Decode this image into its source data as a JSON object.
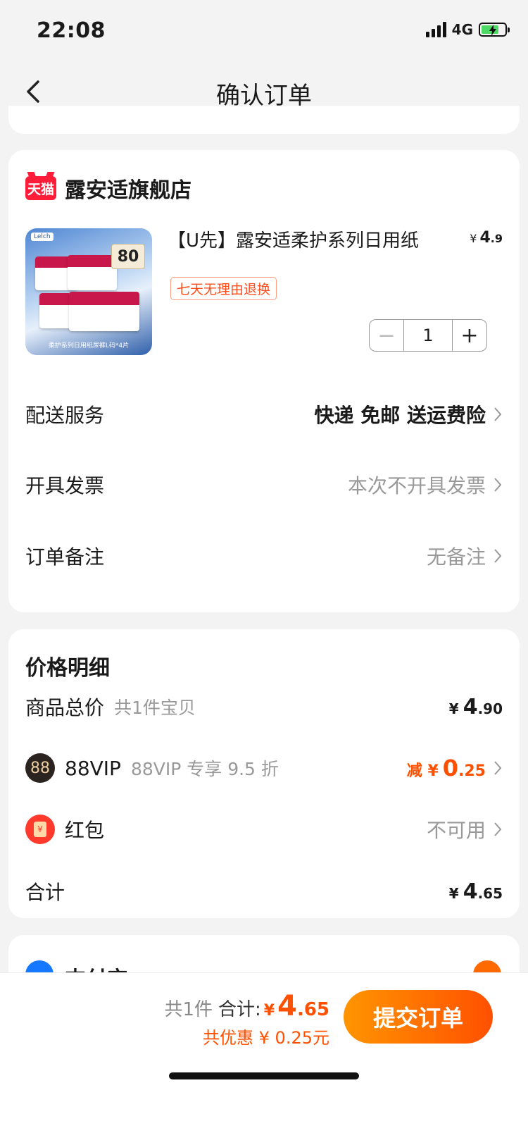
{
  "status": {
    "time": "22:08",
    "network": "4G"
  },
  "nav": {
    "title": "确认订单"
  },
  "store": {
    "logo_text": "天猫",
    "name": "露安适旗舰店",
    "product": {
      "title": "【U先】露安适柔护系列日用纸",
      "price_symbol": "¥",
      "price_int": "4",
      "price_dec": ".9",
      "tag": "七天无理由退换",
      "quantity": "1",
      "image_badge": "80",
      "image_brand": "Lelch",
      "image_caption": "柔护系列日用纸尿裤L码*4片"
    }
  },
  "rows": {
    "delivery": {
      "label": "配送服务",
      "value": "快递 免邮 送运费险"
    },
    "invoice": {
      "label": "开具发票",
      "value": "本次不开具发票"
    },
    "remark": {
      "label": "订单备注",
      "value": "无备注"
    }
  },
  "price_detail": {
    "title": "价格明细",
    "goods": {
      "label": "商品总价",
      "sub": "共1件宝贝",
      "symbol": "¥",
      "int": "4",
      "dec": ".90"
    },
    "vip": {
      "icon_text": "88",
      "label": "88VIP",
      "sub": "88VIP 专享 9.5 折",
      "prefix": "减 ¥",
      "int": "0",
      "dec": ".25"
    },
    "redpacket": {
      "icon_text": "¥",
      "label": "红包",
      "value": "不可用"
    },
    "total": {
      "label": "合计",
      "symbol": "¥",
      "int": "4",
      "dec": ".65"
    }
  },
  "payment": {
    "name": "支付宝"
  },
  "bottom": {
    "count": "共1件",
    "total_label": "合计:",
    "symbol": "¥",
    "int": "4",
    "dec": ".65",
    "saving": "共优惠 ¥ 0.25元",
    "submit": "提交订单"
  },
  "colors": {
    "accent": "#ff5000",
    "tmall": "#ff1d3a"
  }
}
